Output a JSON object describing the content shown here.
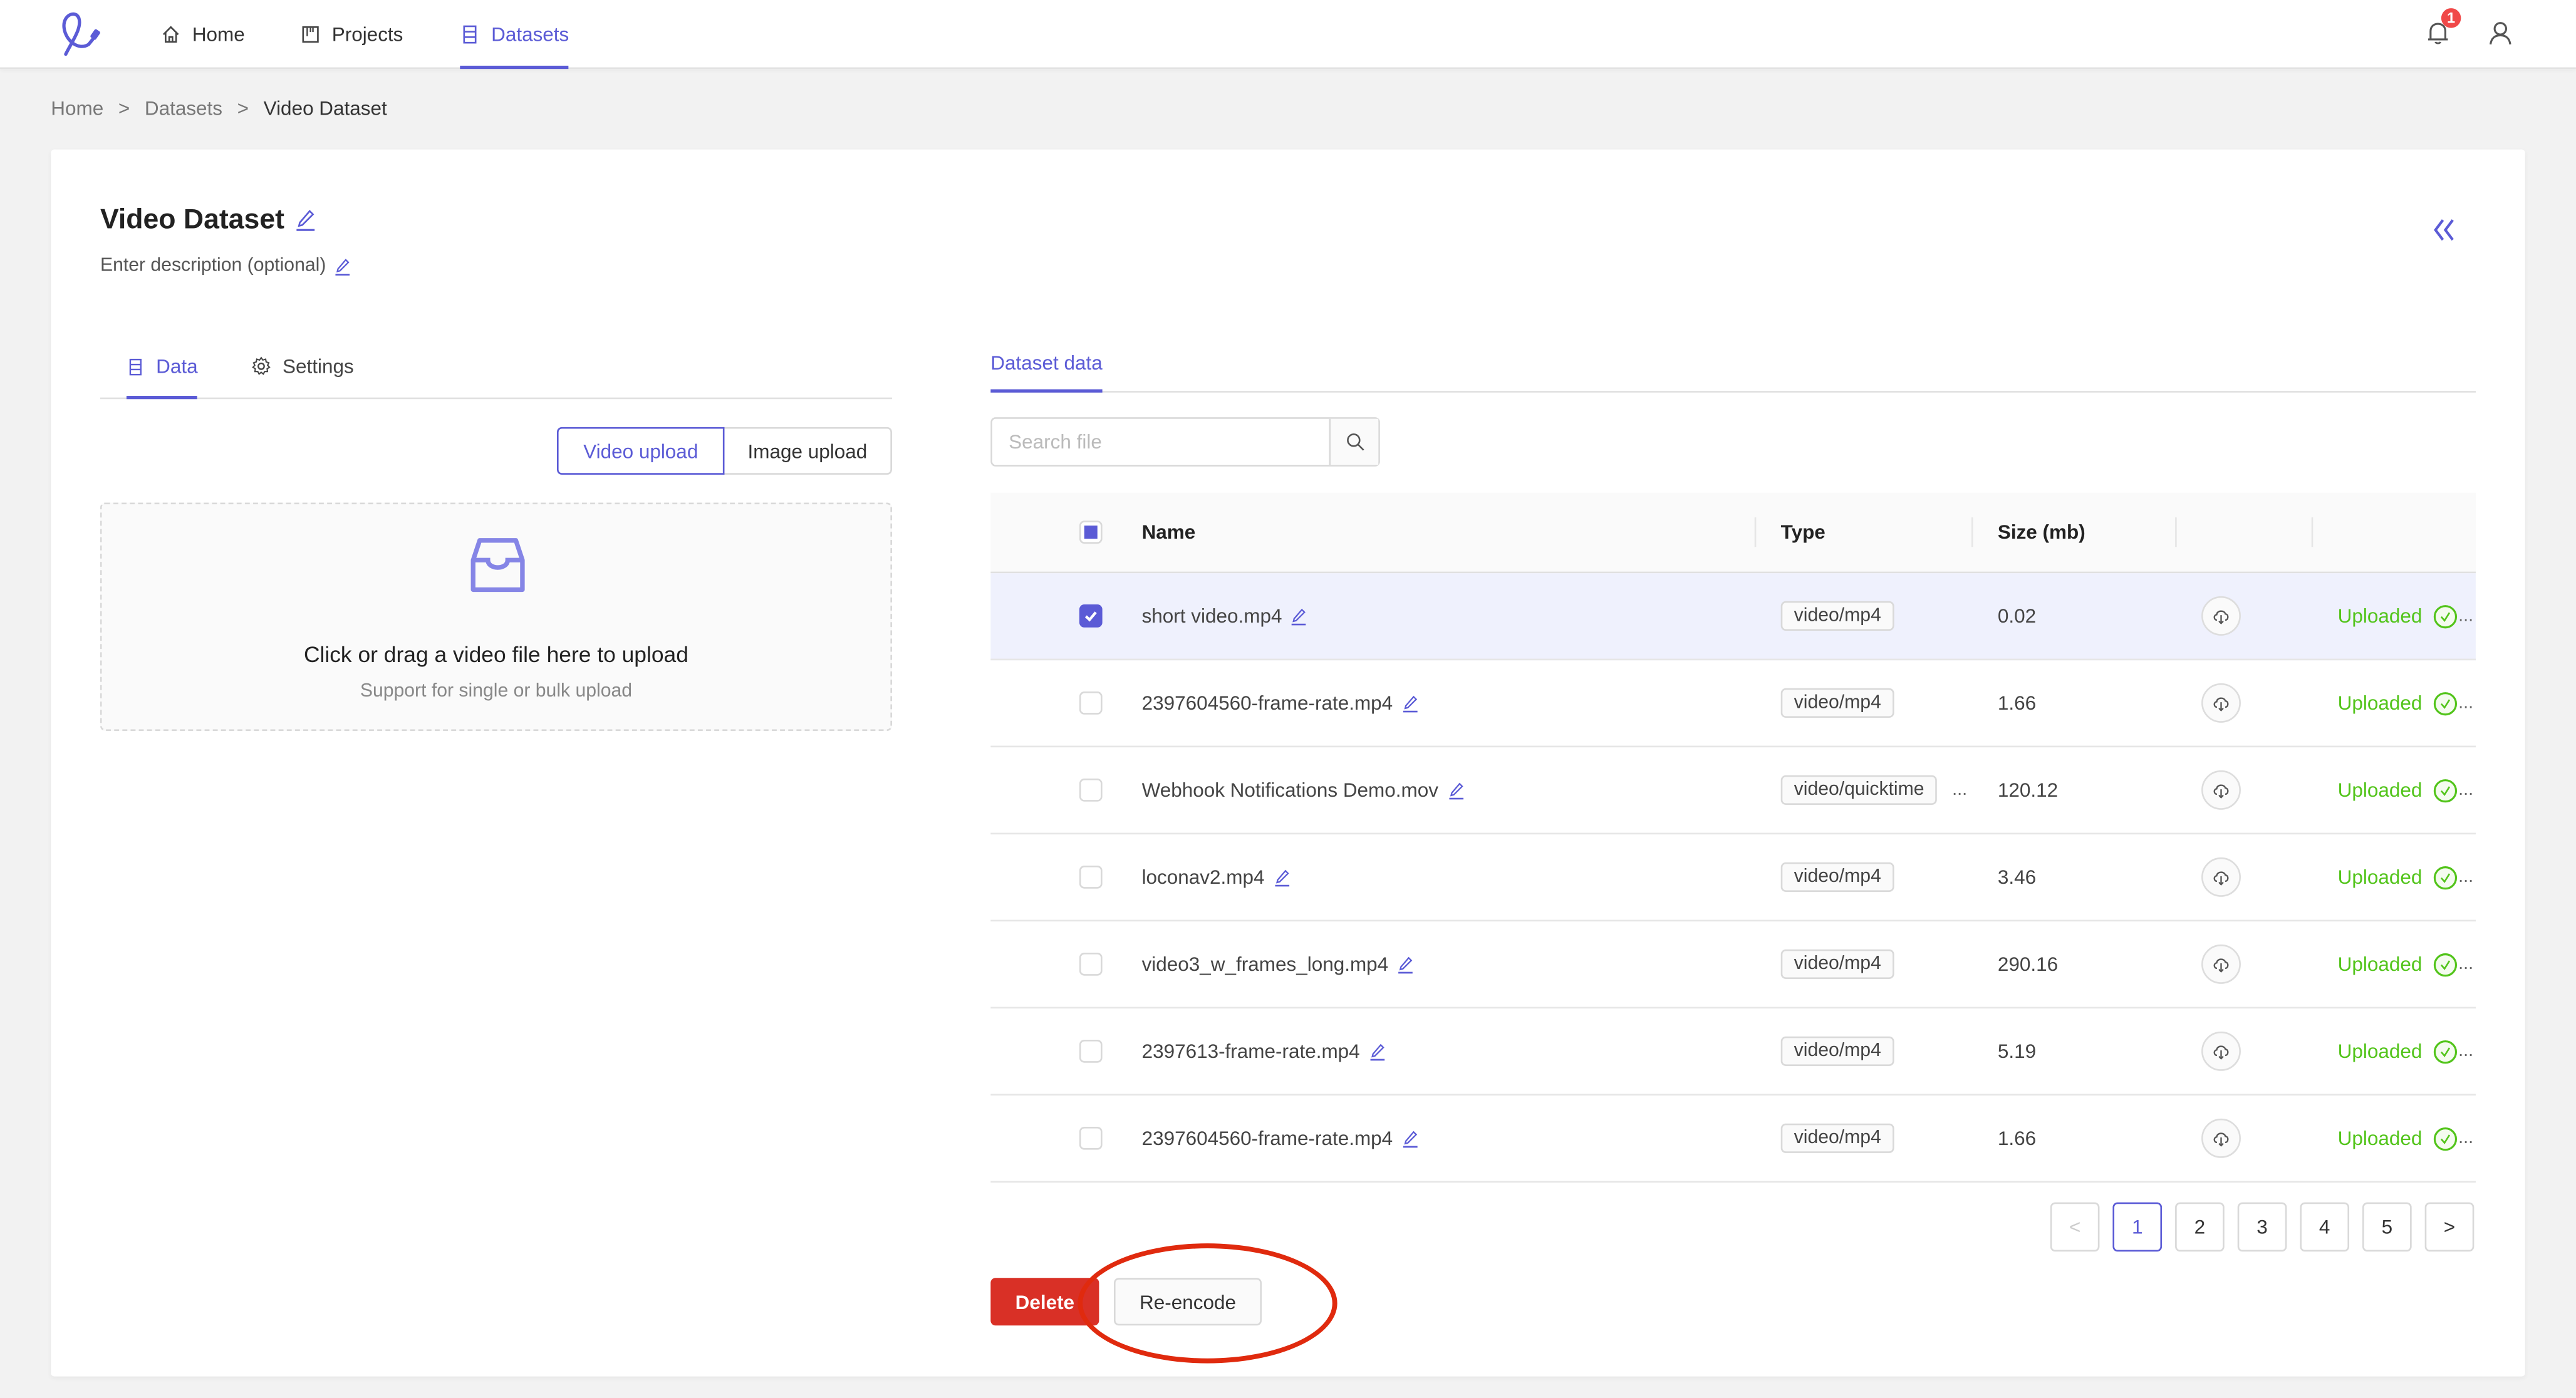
{
  "colors": {
    "accent": "#5b5bd6",
    "danger": "#d93026",
    "success": "#52c41a",
    "badge": "#f04848",
    "annotation": "#e02a0e"
  },
  "nav": {
    "logo_icon": "app-logo",
    "items": [
      {
        "label": "Home",
        "icon": "home-icon",
        "active": false
      },
      {
        "label": "Projects",
        "icon": "projects-icon",
        "active": false
      },
      {
        "label": "Datasets",
        "icon": "datasets-icon",
        "active": true
      }
    ],
    "notifications_count": "1"
  },
  "breadcrumb": {
    "items": [
      "Home",
      "Datasets",
      "Video Dataset"
    ],
    "separator": ">"
  },
  "dataset": {
    "title": "Video Dataset",
    "description_placeholder": "Enter description (optional)"
  },
  "left_tabs": [
    {
      "label": "Data",
      "active": true
    },
    {
      "label": "Settings",
      "active": false
    }
  ],
  "upload": {
    "modes": [
      {
        "label": "Video upload",
        "active": true
      },
      {
        "label": "Image upload",
        "active": false
      }
    ],
    "dropzone_title": "Click or drag a video file here to upload",
    "dropzone_subtitle": "Support for single or bulk upload"
  },
  "right_tabs": [
    {
      "label": "Dataset data",
      "active": true
    }
  ],
  "search": {
    "placeholder": "Search file",
    "value": ""
  },
  "table": {
    "columns": [
      "Name",
      "Type",
      "Size (mb)",
      "",
      ""
    ],
    "header_checkbox": "indeterminate",
    "rows": [
      {
        "selected": true,
        "name": "short video.mp4",
        "type": "video/mp4",
        "type_truncated": false,
        "size": "0.02",
        "status": "Uploaded"
      },
      {
        "selected": false,
        "name": "2397604560-frame-rate.mp4",
        "type": "video/mp4",
        "type_truncated": false,
        "size": "1.66",
        "status": "Uploaded"
      },
      {
        "selected": false,
        "name": "Webhook Notifications Demo.mov",
        "type": "video/quicktime",
        "type_truncated": true,
        "size": "120.12",
        "status": "Uploaded"
      },
      {
        "selected": false,
        "name": "loconav2.mp4",
        "type": "video/mp4",
        "type_truncated": false,
        "size": "3.46",
        "status": "Uploaded"
      },
      {
        "selected": false,
        "name": "video3_w_frames_long.mp4",
        "type": "video/mp4",
        "type_truncated": false,
        "size": "290.16",
        "status": "Uploaded"
      },
      {
        "selected": false,
        "name": "2397613-frame-rate.mp4",
        "type": "video/mp4",
        "type_truncated": false,
        "size": "5.19",
        "status": "Uploaded"
      },
      {
        "selected": false,
        "name": "2397604560-frame-rate.mp4",
        "type": "video/mp4",
        "type_truncated": false,
        "size": "1.66",
        "status": "Uploaded"
      }
    ],
    "ellipsis": "..."
  },
  "pagination": {
    "prev": "<",
    "next": ">",
    "pages": [
      "1",
      "2",
      "3",
      "4",
      "5"
    ],
    "current": "1"
  },
  "actions": {
    "delete_label": "Delete",
    "reencode_label": "Re-encode"
  }
}
